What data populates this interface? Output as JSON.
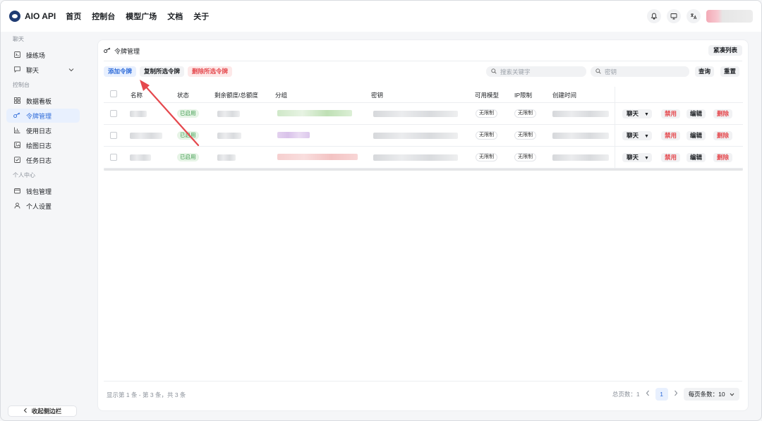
{
  "app": {
    "brand": "AIO API",
    "nav": [
      "首页",
      "控制台",
      "模型广场",
      "文档",
      "关于"
    ]
  },
  "header": {
    "icons": [
      "bell-icon",
      "monitor-icon",
      "translate-icon"
    ]
  },
  "sidebar": {
    "sections": [
      {
        "title": "聊天",
        "items": [
          {
            "label": "操练场",
            "icon": "playground-icon"
          },
          {
            "label": "聊天",
            "icon": "chat-icon",
            "has_chevron": true
          }
        ]
      },
      {
        "title": "控制台",
        "items": [
          {
            "label": "数据看板",
            "icon": "dashboard-icon"
          },
          {
            "label": "令牌管理",
            "icon": "key-icon",
            "active": true
          },
          {
            "label": "使用日志",
            "icon": "bar-chart-icon"
          },
          {
            "label": "绘图日志",
            "icon": "image-icon"
          },
          {
            "label": "任务日志",
            "icon": "task-icon"
          }
        ]
      },
      {
        "title": "个人中心",
        "items": [
          {
            "label": "钱包管理",
            "icon": "wallet-icon"
          },
          {
            "label": "个人设置",
            "icon": "user-icon"
          }
        ]
      }
    ],
    "collapse_label": "收起侧边栏"
  },
  "panel": {
    "title": "令牌管理",
    "compact_label": "紧凑列表",
    "toolbar": {
      "add": "添加令牌",
      "copy": "复制所选令牌",
      "delete": "删除所选令牌"
    },
    "search": {
      "keyword_placeholder": "搜索关键字",
      "key_placeholder": "密钥",
      "query": "查询",
      "reset": "重置"
    },
    "columns": [
      "名称",
      "状态",
      "剩余额度/总额度",
      "分组",
      "密钥",
      "可用模型",
      "IP限制",
      "创建时间"
    ],
    "rows": [
      {
        "status": "已启用",
        "models": "无限制",
        "ip": "无限制",
        "group_color": "green"
      },
      {
        "status": "已启用",
        "models": "无限制",
        "ip": "无限制",
        "group_color": "purple"
      },
      {
        "status": "已启用",
        "models": "无限制",
        "ip": "无限制",
        "group_color": "red"
      }
    ],
    "actions": {
      "chat": "聊天",
      "disable": "禁用",
      "edit": "编辑",
      "delete": "删除"
    },
    "footer": {
      "info": "显示第 1 条 - 第 3 条，共 3 条",
      "total_pages": "总页数：1",
      "current_page": "1",
      "page_size": "每页条数：10"
    }
  },
  "colors": {
    "primary": "#2e6bd9",
    "danger": "#e5484d",
    "success": "#3a9a4a",
    "annotation": "#e5484d"
  }
}
